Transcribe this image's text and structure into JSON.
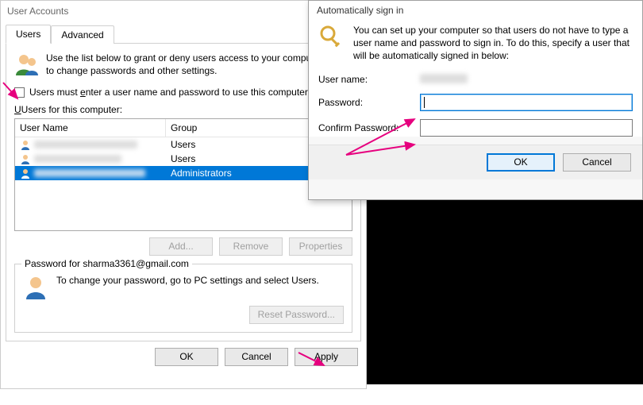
{
  "window": {
    "title": "User Accounts",
    "tabs": {
      "users": "Users",
      "advanced": "Advanced"
    },
    "intro": "Use the list below to grant or deny users access to your computer, and to change passwords and other settings.",
    "checkbox": {
      "prefix": "Users must ",
      "u": "e",
      "mid": "nter a user name and password to use this computer."
    },
    "userslist_label_prefix": "",
    "userslist_label": "Users for this computer:",
    "columns": {
      "name": "User Name",
      "group": "Group"
    },
    "rows": [
      {
        "name": "user1@outlook.com",
        "group": "Users",
        "selected": false
      },
      {
        "name": "user2@gmail.com",
        "group": "Users",
        "selected": false
      },
      {
        "name": "sharma3361@gmail.com",
        "group": "Administrators",
        "selected": true
      }
    ],
    "buttons": {
      "add": "Add...",
      "remove": "Remove",
      "properties": "Properties"
    },
    "password_group": {
      "title": "Password for sharma3361@gmail.com",
      "text": "To change your password, go to PC settings and select Users.",
      "reset": "Reset Password..."
    },
    "footer": {
      "ok": "OK",
      "cancel": "Cancel",
      "apply": "Apply"
    }
  },
  "dialog": {
    "title": "Automatically sign in",
    "intro": "You can set up your computer so that users do not have to type a user name and password to sign in. To do this, specify a user that will be automatically signed in below:",
    "labels": {
      "username": "User name:",
      "password": "Password:",
      "confirm": "Confirm Password:"
    },
    "values": {
      "username": "sharma",
      "password": "",
      "confirm": ""
    },
    "buttons": {
      "ok": "OK",
      "cancel": "Cancel"
    }
  }
}
